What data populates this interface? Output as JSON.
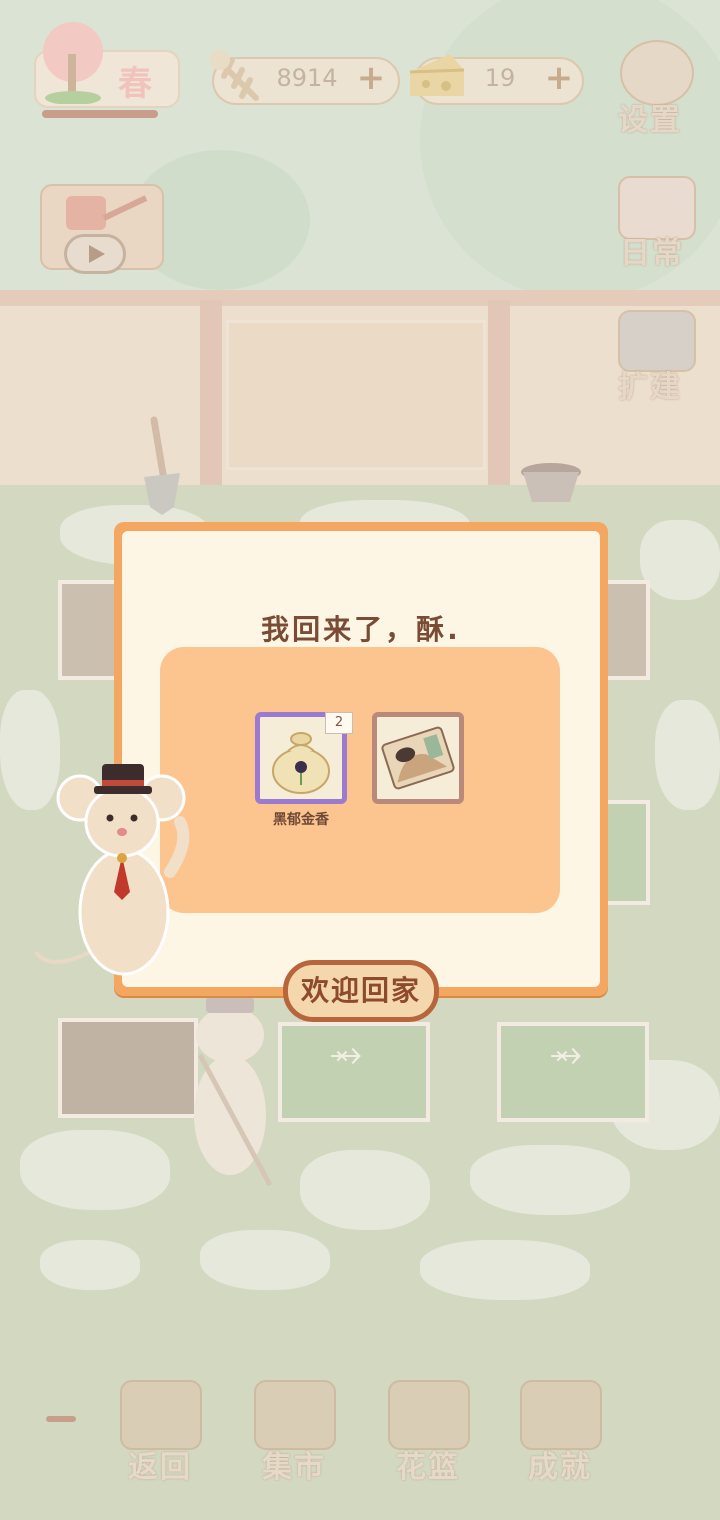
{
  "season": {
    "label": "春",
    "progress_percent": 100
  },
  "currency": {
    "fish": {
      "value": "8914",
      "icon": "fish-bone-icon"
    },
    "cheese": {
      "value": "19",
      "icon": "cheese-icon"
    }
  },
  "side_buttons": [
    {
      "label": "设置",
      "icon": "gear-icon"
    },
    {
      "label": "日常",
      "icon": "tips-note-icon"
    },
    {
      "label": "扩建",
      "icon": "hammer-icon"
    }
  ],
  "dialog": {
    "message": "我回来了，酥.",
    "rewards": [
      {
        "name": "黑郁金香",
        "count": "2",
        "icon": "seed-bag-icon",
        "frame": "purple"
      },
      {
        "name": "",
        "count": "",
        "icon": "postcard-icon",
        "frame": "brown"
      }
    ],
    "confirm_label": "欢迎回家"
  },
  "bottom_nav": [
    {
      "label": "返回",
      "icon": "window-icon"
    },
    {
      "label": "集市",
      "icon": "market-stall-icon"
    },
    {
      "label": "花篮",
      "icon": "flower-basket-icon"
    },
    {
      "label": "成就",
      "icon": "trophy-icon"
    }
  ],
  "colors": {
    "dialog_border": "#f4a760",
    "dialog_bg": "#fdf6e4",
    "reward_panel": "#fcc48f",
    "confirm_border": "#b9653c",
    "rare_frame": "#9c7ad0"
  }
}
